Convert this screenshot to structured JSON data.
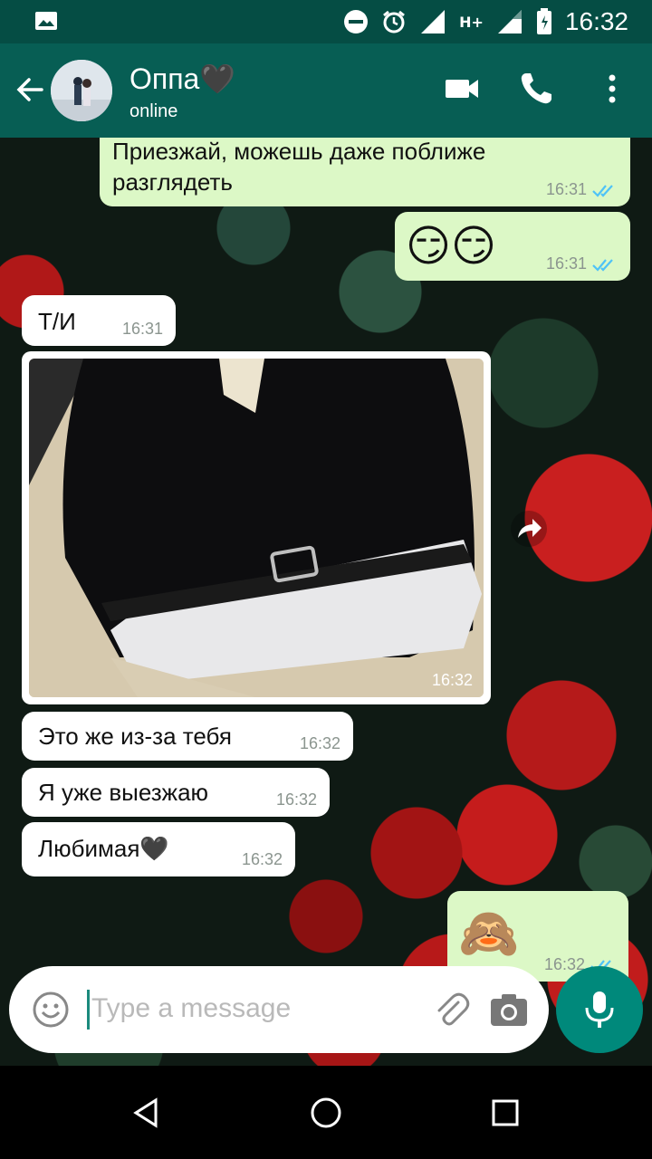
{
  "status_bar": {
    "time": "16:32",
    "network_label": "H+",
    "battery_indicator": "battery-icon"
  },
  "header": {
    "contact_name": "Оппа🖤",
    "contact_status": "online"
  },
  "messages": [
    {
      "id": "m1",
      "direction": "out",
      "text_line1": "Приезжай, можешь даже поближе",
      "text_line2": "разглядеть",
      "time": "16:31"
    },
    {
      "id": "m2",
      "direction": "out",
      "text": "😏😏",
      "time": "16:31"
    },
    {
      "id": "m3",
      "direction": "in",
      "text": "Т/И",
      "time": "16:31"
    },
    {
      "id": "m4",
      "direction": "in",
      "type": "photo",
      "time": "16:32"
    },
    {
      "id": "m5",
      "direction": "in",
      "text": "Это же из-за тебя",
      "time": "16:32"
    },
    {
      "id": "m6",
      "direction": "in",
      "text": "Я уже выезжаю",
      "time": "16:32"
    },
    {
      "id": "m7",
      "direction": "in",
      "text": "Любимая🖤",
      "time": "16:32"
    },
    {
      "id": "m8",
      "direction": "out",
      "text": "🙈",
      "time": "16:32"
    }
  ],
  "composer": {
    "placeholder": "Type a message"
  },
  "colors": {
    "header": "#075e54",
    "status_bar": "#054d44",
    "outgoing": "#dcf8c6",
    "incoming": "#ffffff",
    "accent": "#00897b",
    "read_ticks": "#4fc3f7"
  }
}
